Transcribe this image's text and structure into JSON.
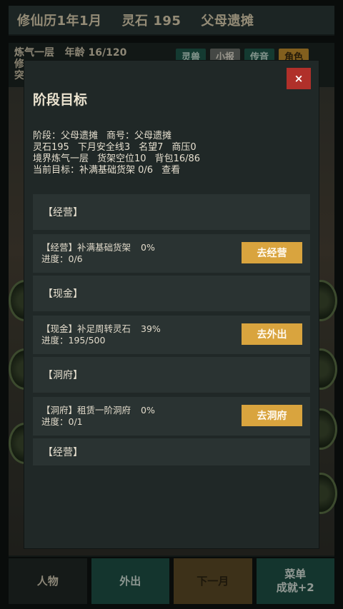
{
  "topbar": {
    "date": "修仙历1年1月",
    "spirit_stones": "灵石 195",
    "stage": "父母遗摊"
  },
  "status": {
    "realm": "炼气一层",
    "age": "年龄 16/120",
    "line2": "修",
    "line3": "突"
  },
  "tabs": [
    {
      "label": "灵兽"
    },
    {
      "label": "小报"
    },
    {
      "label": "传音"
    },
    {
      "label": "角色"
    }
  ],
  "modal": {
    "title": "阶段目标",
    "close_label": "×",
    "info": {
      "stage": "阶段：父母遗摊",
      "shop_name": "商号：父母遗摊",
      "stones": "灵石195",
      "safety": "下月安全线3",
      "reputation": "名望7",
      "pressure": "商压0",
      "realm": "境界炼气一层",
      "shelf_slots": "货架空位10",
      "bag": "背包16/86",
      "current_goal": "当前目标：补满基础货架 0/6",
      "view_link": "查看"
    },
    "sections": [
      {
        "header": "【经营】",
        "goal": {
          "title": "【经营】补满基础货架",
          "percent": "0%",
          "progress": "进度：0/6",
          "button": "去经营"
        }
      },
      {
        "header": "【现金】",
        "goal": {
          "title": "【现金】补足周转灵石",
          "percent": "39%",
          "progress": "进度：195/500",
          "button": "去外出"
        }
      },
      {
        "header": "【洞府】",
        "goal": {
          "title": "【洞府】租赁一阶洞府",
          "percent": "0%",
          "progress": "进度：0/1",
          "button": "去洞府"
        }
      },
      {
        "header": "【经营】"
      }
    ]
  },
  "dock": {
    "character": "人物",
    "go_out": "外出",
    "next_month": "下一月",
    "menu": "菜单",
    "achievement": "成就+2"
  },
  "colors": {
    "accent_gold": "#d9a43e",
    "close_red": "#b0302a",
    "teal": "#1f5248",
    "modal_bg": "#202827"
  }
}
